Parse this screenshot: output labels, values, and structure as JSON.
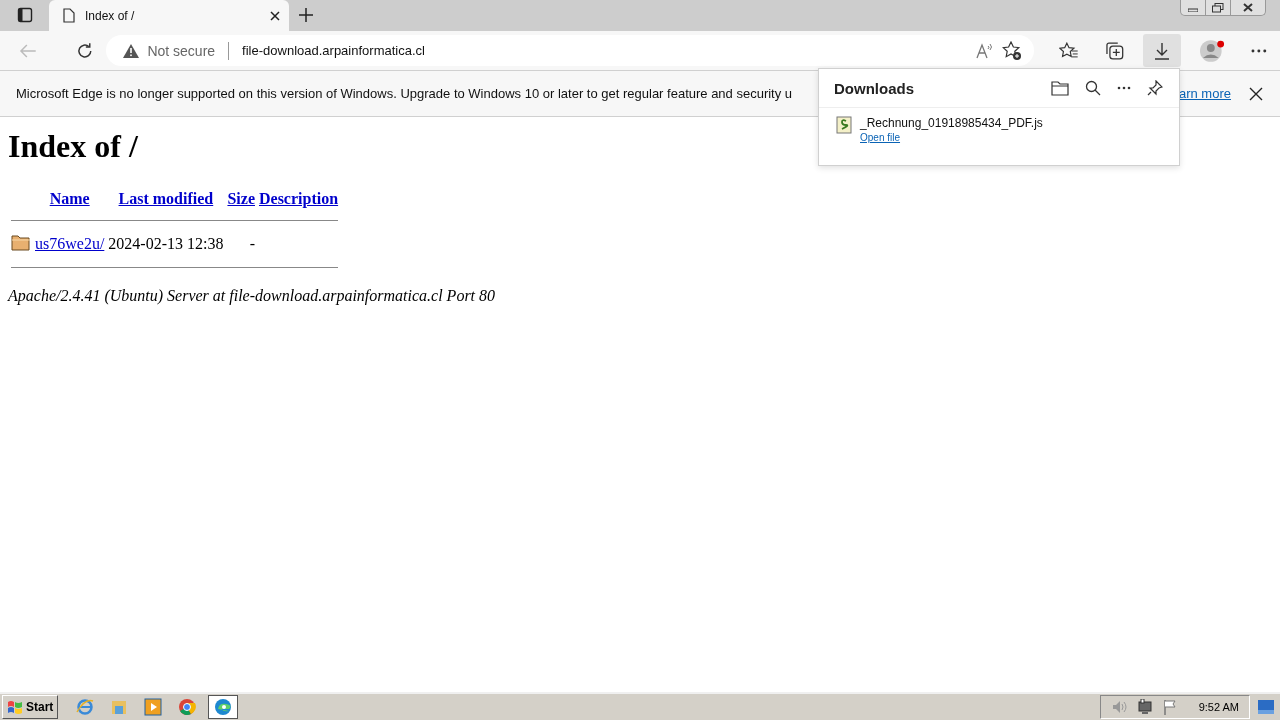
{
  "browser": {
    "tabs": [
      {
        "title": "Index of /",
        "selected": true
      }
    ],
    "address": {
      "security": "Not secure",
      "url": "file-download.arpainformatica.cl"
    },
    "downloads_button": {
      "selected": true
    }
  },
  "infobar": {
    "message": "Microsoft Edge is no longer supported on this version of Windows. Upgrade to Windows 10 or later to get regular feature and security u",
    "link": "arn more"
  },
  "downloads_panel": {
    "title": "Downloads",
    "items": [
      {
        "file": "_Rechnung_01918985434_PDF.js",
        "action": "Open file"
      }
    ]
  },
  "page": {
    "heading": "Index of /",
    "columns": [
      "Name",
      "Last modified",
      "Size",
      "Description"
    ],
    "rows": [
      {
        "name": "us76we2u/",
        "modified": "2024-02-13 12:38",
        "size": "-"
      }
    ],
    "footer": "Apache/2.4.41 (Ubuntu) Server at file-download.arpainformatica.cl Port 80"
  },
  "taskbar": {
    "start": "Start",
    "apps": [
      {
        "kind": "ie",
        "selected": false
      },
      {
        "kind": "explorer",
        "selected": false
      },
      {
        "kind": "media",
        "selected": false
      },
      {
        "kind": "chrome",
        "selected": false
      },
      {
        "kind": "edge",
        "selected": true
      }
    ],
    "clock": "9:52 AM"
  }
}
